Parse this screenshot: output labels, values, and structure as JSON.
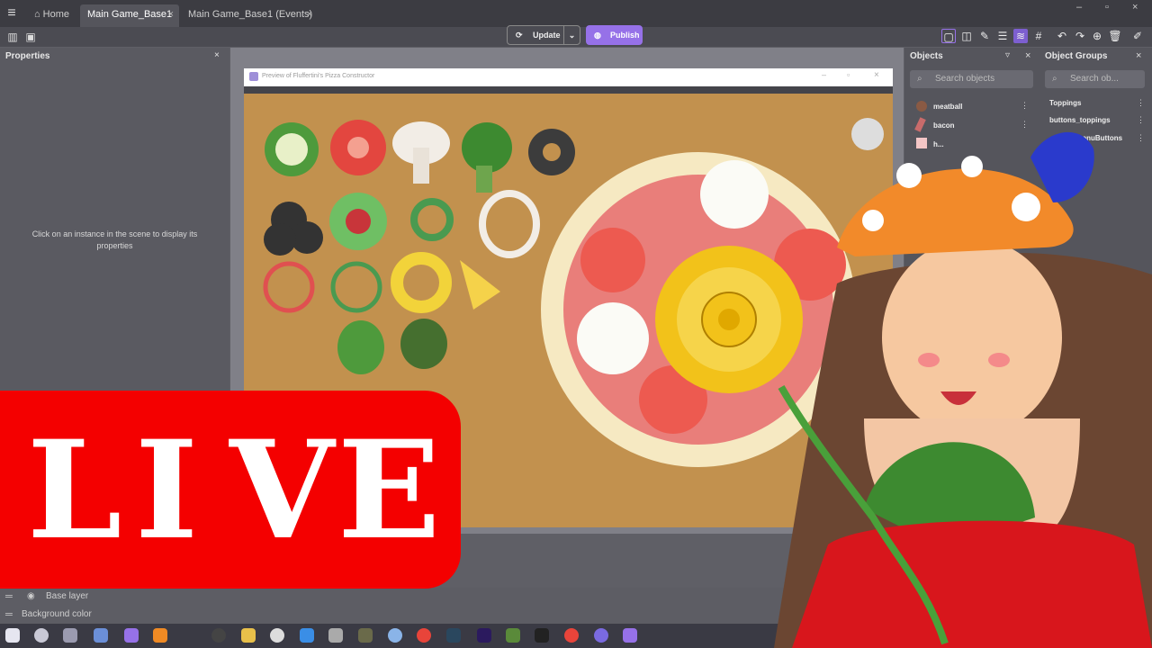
{
  "tabs": {
    "home": "Home",
    "main": "Main Game_Base1",
    "events": "Main Game_Base1 (Events)"
  },
  "toolbar": {
    "update": "Update",
    "publish": "Publish"
  },
  "properties": {
    "title": "Properties",
    "message": "Click on an instance in the scene to display its properties"
  },
  "preview": {
    "title": "Preview of Fluffertini's Pizza Constructor"
  },
  "objects": {
    "title": "Objects",
    "search_placeholder": "Search objects",
    "items": [
      "meatball",
      "bacon",
      "h..."
    ]
  },
  "object_groups": {
    "title": "Object Groups",
    "search_placeholder": "Search ob...",
    "items": [
      "Toppings",
      "buttons_toppings",
      "...enuButtons"
    ]
  },
  "layers": {
    "base": "Base layer",
    "bg": "Background color"
  },
  "overlay": {
    "live_letters": [
      "L",
      "I",
      "V",
      "E"
    ]
  },
  "colors": {
    "accent": "#9671e8",
    "live": "#f40000"
  }
}
